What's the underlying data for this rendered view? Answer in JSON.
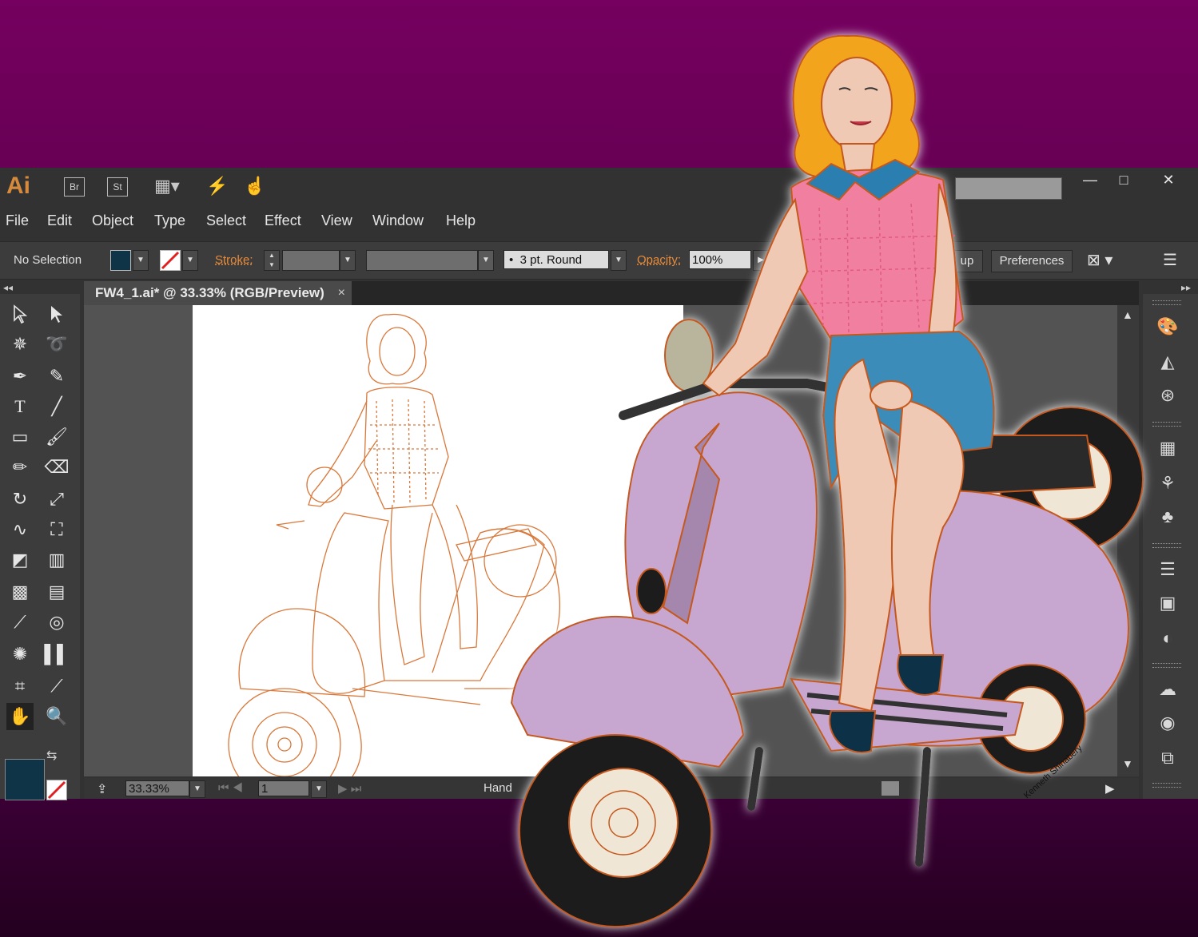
{
  "app": {
    "logo": "Ai",
    "badges": [
      "Br",
      "St"
    ]
  },
  "menu": [
    "File",
    "Edit",
    "Object",
    "Type",
    "Select",
    "Effect",
    "View",
    "Window",
    "Help"
  ],
  "control_bar": {
    "selection_label": "No Selection",
    "fill_color": "#0f3347",
    "stroke_label": "Stroke:",
    "brush_profile": "3 pt. Round",
    "opacity_label": "Opacity:",
    "opacity_value": "100%",
    "setup_partial": "up",
    "preferences_label": "Preferences"
  },
  "document": {
    "tab_title": "FW4_1.ai* @ 33.33% (RGB/Preview)",
    "close": "×"
  },
  "status_bar": {
    "zoom": "33.33%",
    "artboard_number": "1",
    "tool_name": "Hand"
  },
  "window_controls": {
    "minimize": "—",
    "maximize": "□",
    "close": "✕"
  },
  "toolbox": {
    "fill_color": "#0f3347"
  },
  "artwork": {
    "signature": "Kenneth Shinabery"
  },
  "colors": {
    "accent": "#e78b3a",
    "background": "#6a0058",
    "scooter": "#c7a6cf",
    "shirt": "#f07fa0",
    "shorts": "#3a8cb8",
    "hair": "#f2a41f"
  }
}
